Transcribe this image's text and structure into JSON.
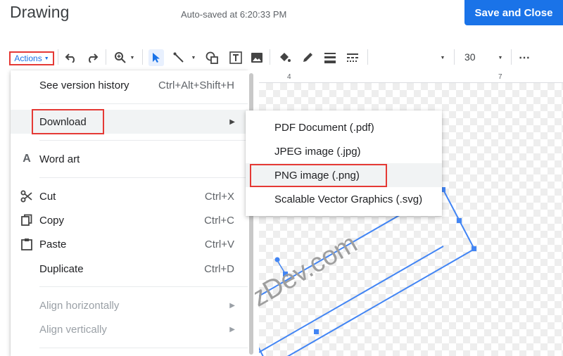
{
  "header": {
    "title": "Drawing",
    "autosave": "Auto-saved at 6:20:33 PM",
    "save_close": "Save and Close"
  },
  "toolbar": {
    "actions_label": "Actions",
    "zoom_value": "30"
  },
  "ruler": {
    "marks": [
      "4",
      "7"
    ]
  },
  "menu": {
    "items": [
      {
        "label": "See version history",
        "shortcut": "Ctrl+Alt+Shift+H"
      },
      {
        "label": "Download",
        "submenu": true
      },
      {
        "label": "Word art",
        "icon": "word-art-icon"
      },
      {
        "label": "Cut",
        "shortcut": "Ctrl+X",
        "icon": "scissors-icon"
      },
      {
        "label": "Copy",
        "shortcut": "Ctrl+C",
        "icon": "copy-icon"
      },
      {
        "label": "Paste",
        "shortcut": "Ctrl+V",
        "icon": "clipboard-icon"
      },
      {
        "label": "Duplicate",
        "shortcut": "Ctrl+D"
      },
      {
        "label": "Align horizontally",
        "submenu": true,
        "disabled": true
      },
      {
        "label": "Align vertically",
        "submenu": true,
        "disabled": true
      }
    ]
  },
  "submenu": {
    "items": [
      {
        "label": "PDF Document (.pdf)"
      },
      {
        "label": "JPEG image (.jpg)"
      },
      {
        "label": "PNG image (.png)"
      },
      {
        "label": "Scalable Vector Graphics (.svg)"
      }
    ]
  },
  "canvas": {
    "watermark": "zDev.com"
  },
  "colors": {
    "accent": "#1a73e8",
    "highlight": "#e53935",
    "hover": "#f1f3f4"
  }
}
